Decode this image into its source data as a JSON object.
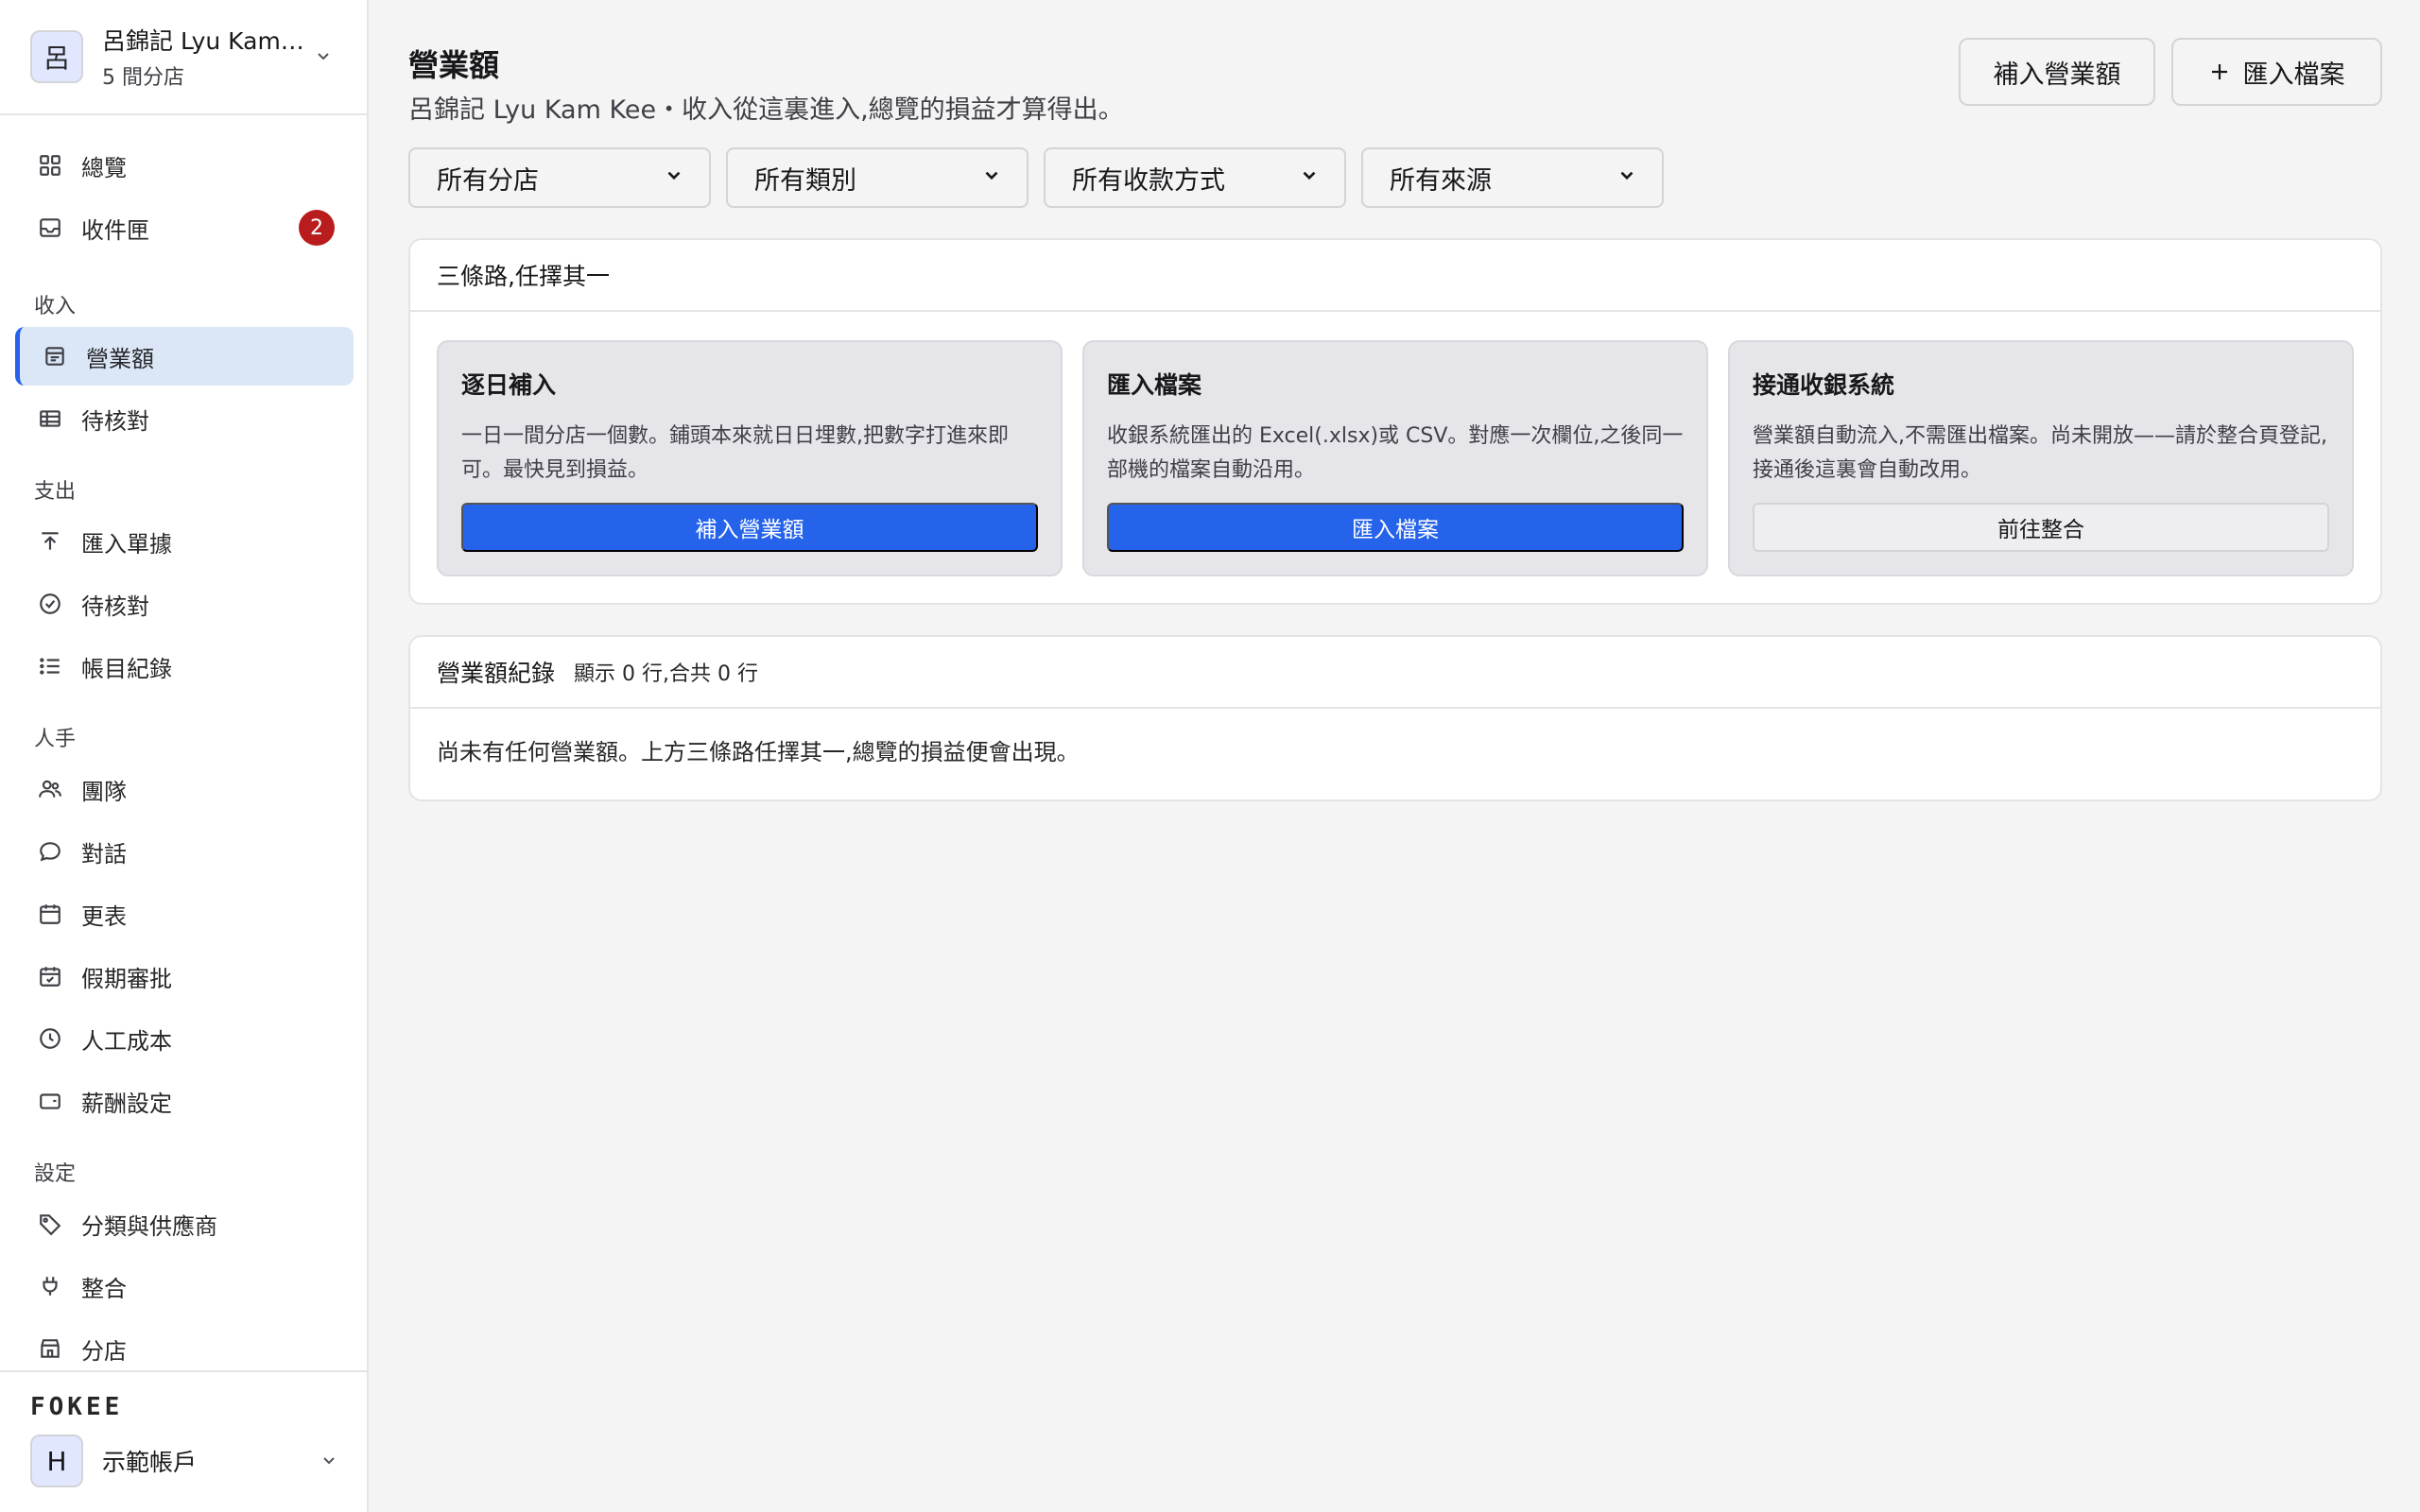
{
  "org": {
    "avatar": "呂",
    "name": "呂錦記 Lyu Kam Kee",
    "stores": "5 間分店"
  },
  "nav": {
    "overview": "總覽",
    "inbox": "收件匣",
    "inbox_badge": "2",
    "sec_income": "收入",
    "sales": "營業額",
    "income_pending": "待核對",
    "sec_expense": "支出",
    "import_receipts": "匯入單據",
    "expense_pending": "待核對",
    "ledger": "帳目紀錄",
    "sec_staff": "人手",
    "team": "團隊",
    "chat": "對話",
    "roster": "更表",
    "leave": "假期審批",
    "labor_cost": "人工成本",
    "payroll": "薪酬設定",
    "sec_settings": "設定",
    "categories": "分類與供應商",
    "integrations": "整合",
    "branches": "分店"
  },
  "footer": {
    "brand": "FOKEE",
    "account_avatar": "H",
    "account_name": "示範帳戶"
  },
  "header": {
    "title": "營業額",
    "subtitle": "呂錦記 Lyu Kam Kee・收入從這裏進入,總覽的損益才算得出。",
    "add_sales_btn": "補入營業額",
    "import_btn": "匯入檔案"
  },
  "filters": [
    "所有分店",
    "所有類別",
    "所有收款方式",
    "所有來源"
  ],
  "paths_card": {
    "title": "三條路,任擇其一",
    "paths": [
      {
        "title": "逐日補入",
        "desc": "一日一間分店一個數。鋪頭本來就日日埋數,把數字打進來即可。最快見到損益。",
        "btn": "補入營業額"
      },
      {
        "title": "匯入檔案",
        "desc": "收銀系統匯出的 Excel(.xlsx)或 CSV。對應一次欄位,之後同一部機的檔案自動沿用。",
        "btn": "匯入檔案"
      },
      {
        "title": "接通收銀系統",
        "desc": "營業額自動流入,不需匯出檔案。尚未開放——請於整合頁登記,接通後這裏會自動改用。",
        "btn": "前往整合"
      }
    ]
  },
  "records_card": {
    "title": "營業額紀錄",
    "meta": "顯示 0 行,合共 0 行",
    "empty": "尚未有任何營業額。上方三條路任擇其一,總覽的損益便會出現。"
  },
  "colors": {
    "accent": "#2563eb",
    "active_bg": "#dbe7f7",
    "badge": "#b91c1c"
  }
}
